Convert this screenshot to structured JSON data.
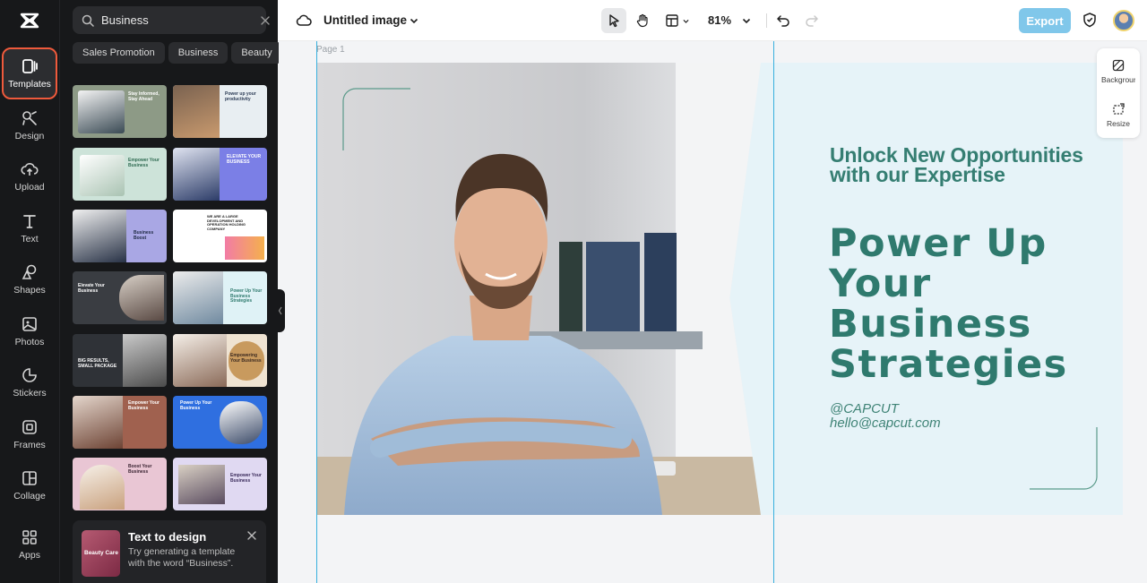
{
  "rail": {
    "items": [
      {
        "label": "Templates",
        "icon": "templates-icon"
      },
      {
        "label": "Design",
        "icon": "design-icon"
      },
      {
        "label": "Upload",
        "icon": "upload-icon"
      },
      {
        "label": "Text",
        "icon": "text-icon"
      },
      {
        "label": "Shapes",
        "icon": "shapes-icon"
      },
      {
        "label": "Photos",
        "icon": "photos-icon"
      },
      {
        "label": "Stickers",
        "icon": "stickers-icon"
      },
      {
        "label": "Frames",
        "icon": "frames-icon"
      },
      {
        "label": "Collage",
        "icon": "collage-icon"
      },
      {
        "label": "Apps",
        "icon": "apps-icon"
      }
    ],
    "active_color": "#ef5a3c"
  },
  "panel": {
    "search_value": "Business",
    "chips": [
      "Sales Promotion",
      "Business",
      "Beauty"
    ],
    "templates": [
      {
        "text": "Stay Informed, Stay Ahead"
      },
      {
        "text": "Power up your productivity"
      },
      {
        "text": "Empower Your Business"
      },
      {
        "text": "ELEVATE YOUR BUSINESS"
      },
      {
        "text": "Business Boost"
      },
      {
        "text": "WE ARE A LARGE DEVELOPMENT AND OPERATION HOLDING COMPANY"
      },
      {
        "text": "Elevate Your Business"
      },
      {
        "text": "Power Up Your Business Strategies"
      },
      {
        "text": "BIG RESULTS, SMALL PACKAGE"
      },
      {
        "text": "Empowering Your Business"
      },
      {
        "text": "Empower Your Business"
      },
      {
        "text": "Power Up Your Business"
      },
      {
        "text": "Boost Your Business"
      },
      {
        "text": "Empower Your Business"
      }
    ],
    "text_to_design": {
      "title": "Text to design",
      "description": "Try generating a template with the word “Business”.",
      "thumb_text": "Beauty Care"
    }
  },
  "topbar": {
    "title": "Untitled image",
    "zoom": "81%",
    "export_label": "Export"
  },
  "canvas": {
    "page_label": "Page 1",
    "headline_small": "Unlock New Opportunities with our Expertise",
    "headline_big": "Power Up Your Business Strategies",
    "handle": "@CAPCUT",
    "email": "hello@capcut.com",
    "accent_color": "#2f7a6e",
    "background_color": "#e6f3f8"
  },
  "float_panel": {
    "items": [
      {
        "label": "Background"
      },
      {
        "label": "Resize"
      }
    ]
  }
}
